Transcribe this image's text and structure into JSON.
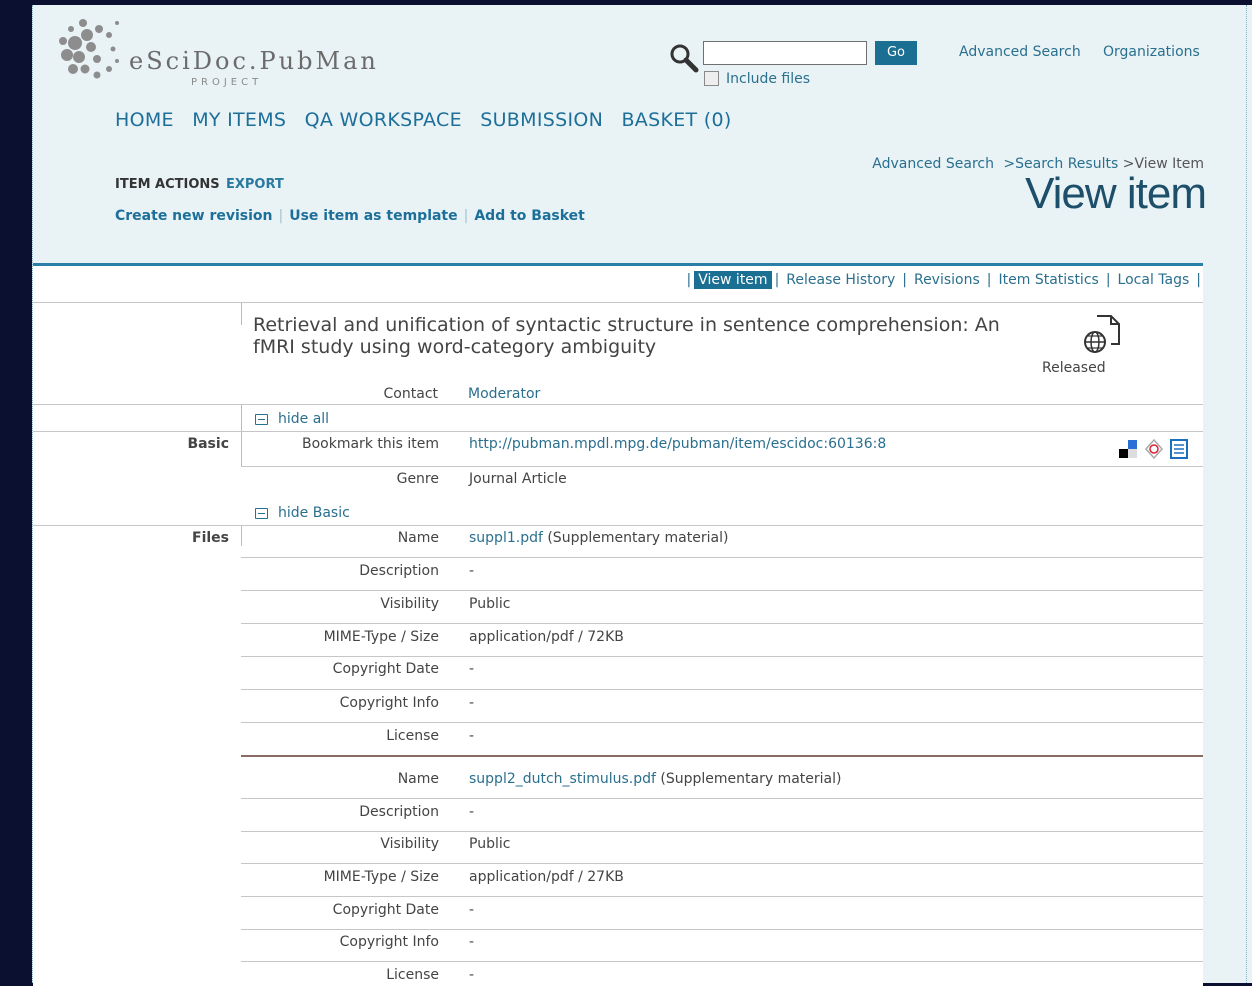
{
  "header": {
    "logo_text": "eSciDoc.PubMan",
    "logo_sub": "PROJECT",
    "search_value": "",
    "go_label": "Go",
    "include_files_label": "Include files",
    "advanced_search": "Advanced Search",
    "organizations": "Organizations"
  },
  "nav": [
    "HOME",
    "MY ITEMS",
    "QA WORKSPACE",
    "SUBMISSION",
    "BASKET (0)"
  ],
  "breadcrumb": {
    "advanced": "Advanced Search",
    "results": "Search Results",
    "current": "View Item",
    "sep": ">"
  },
  "page_title": "View item",
  "item_actions": {
    "label": "ITEM ACTIONS",
    "export": "EXPORT",
    "links": [
      "Create new revision",
      "Use item as template",
      "Add to Basket"
    ]
  },
  "tabs": [
    "View item",
    "Release History",
    "Revisions",
    "Item Statistics",
    "Local Tags"
  ],
  "item": {
    "title": "Retrieval and unification of syntactic structure in sentence comprehension: An fMRI study using word-category ambiguity",
    "status": "Released",
    "contact_label": "Contact",
    "contact_value": "Moderator",
    "hide_all": "hide all"
  },
  "basic": {
    "section": "Basic",
    "bookmark_label": "Bookmark this item",
    "bookmark_url": "http://pubman.mpdl.mpg.de/pubman/item/escidoc:60136:8",
    "genre_label": "Genre",
    "genre_value": "Journal Article",
    "hide": "hide Basic"
  },
  "files": {
    "section": "Files",
    "labels": [
      "Name",
      "Description",
      "Visibility",
      "MIME-Type / Size",
      "Copyright Date",
      "Copyright Info",
      "License"
    ],
    "file1": {
      "name": "suppl1.pdf",
      "name_note": "(Supplementary material)",
      "description": "-",
      "visibility": "Public",
      "mime": "application/pdf / 72KB",
      "copyright_date": "-",
      "copyright_info": "-",
      "license": "-"
    },
    "file2": {
      "name": "suppl2_dutch_stimulus.pdf",
      "name_note": "(Supplementary material)",
      "description": "-",
      "visibility": "Public",
      "mime": "application/pdf / 27KB",
      "copyright_date": "-",
      "copyright_info": "-",
      "license": "-"
    }
  }
}
